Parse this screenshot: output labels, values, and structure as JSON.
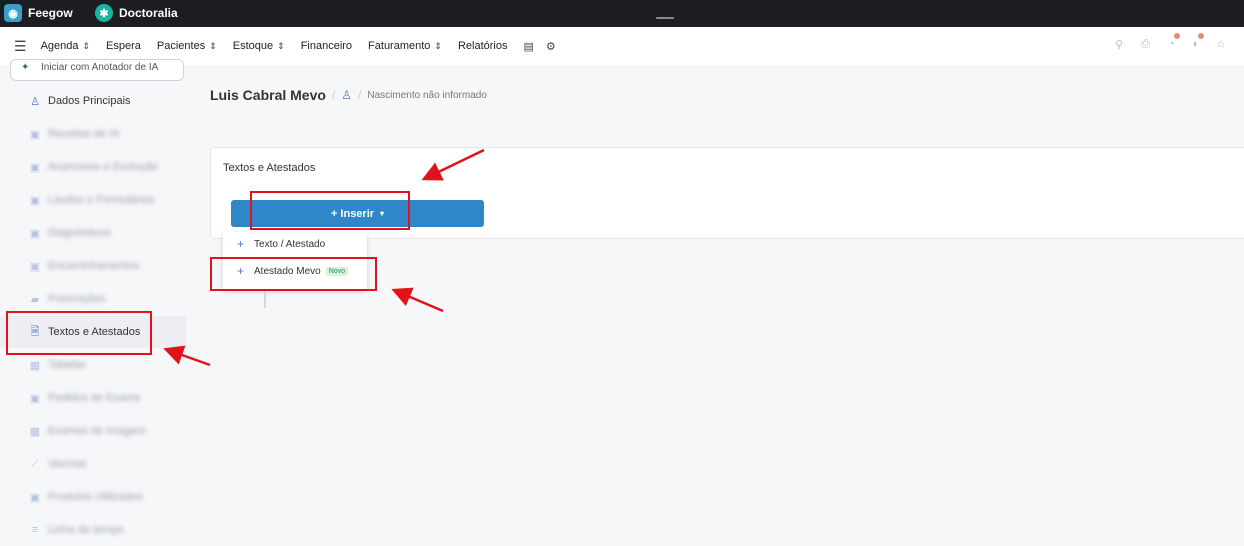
{
  "topbar": {
    "tabs": [
      {
        "label": "Feegow",
        "icon": "feegow-logo-icon"
      },
      {
        "label": "Doctoralia",
        "icon": "doctoralia-logo-icon"
      }
    ]
  },
  "menu": {
    "items": [
      {
        "label": "Agenda",
        "dropdown": true
      },
      {
        "label": "Espera",
        "dropdown": false
      },
      {
        "label": "Pacientes",
        "dropdown": true
      },
      {
        "label": "Estoque",
        "dropdown": true
      },
      {
        "label": "Financeiro",
        "dropdown": false
      },
      {
        "label": "Faturamento",
        "dropdown": true
      },
      {
        "label": "Relatórios",
        "dropdown": false
      }
    ],
    "caret": "⌃⌄"
  },
  "sidebar": {
    "ai_button": "Iniciar com Anotador de IA",
    "items": [
      {
        "label": "Dados Principais",
        "blurred": false
      },
      {
        "label": "Receitas de IA",
        "blurred": true
      },
      {
        "label": "Anamnese e Evolução",
        "blurred": true
      },
      {
        "label": "Laudos e Formulários",
        "blurred": true
      },
      {
        "label": "Diagnósticos",
        "blurred": true
      },
      {
        "label": "Encaminhamentos",
        "blurred": true
      },
      {
        "label": "Prescrições",
        "blurred": true
      },
      {
        "label": "Textos e Atestados",
        "blurred": false,
        "active": true
      },
      {
        "label": "Tabelas",
        "blurred": true
      },
      {
        "label": "Pedidos de Exame",
        "blurred": true
      },
      {
        "label": "Exames de Imagem",
        "blurred": true
      },
      {
        "label": "Vacinas",
        "blurred": true
      },
      {
        "label": "Produtos Utilizados",
        "blurred": true
      },
      {
        "label": "Linha do tempo",
        "blurred": true
      }
    ]
  },
  "breadcrumb": {
    "name": "Luis Cabral Mevo",
    "separator": "/",
    "subtitle": "Nascimento não informado"
  },
  "card": {
    "title": "Textos e Atestados",
    "insert_label": "+ Inserir",
    "insert_caret": "▾"
  },
  "dropdown": {
    "items": [
      {
        "label": "Texto / Atestado",
        "badge": ""
      },
      {
        "label": "Atestado Mevo",
        "badge": "Novo"
      }
    ]
  },
  "colors": {
    "annotation": "#e2121b",
    "primary": "#2f86c8",
    "topbar": "#1b1d22"
  }
}
